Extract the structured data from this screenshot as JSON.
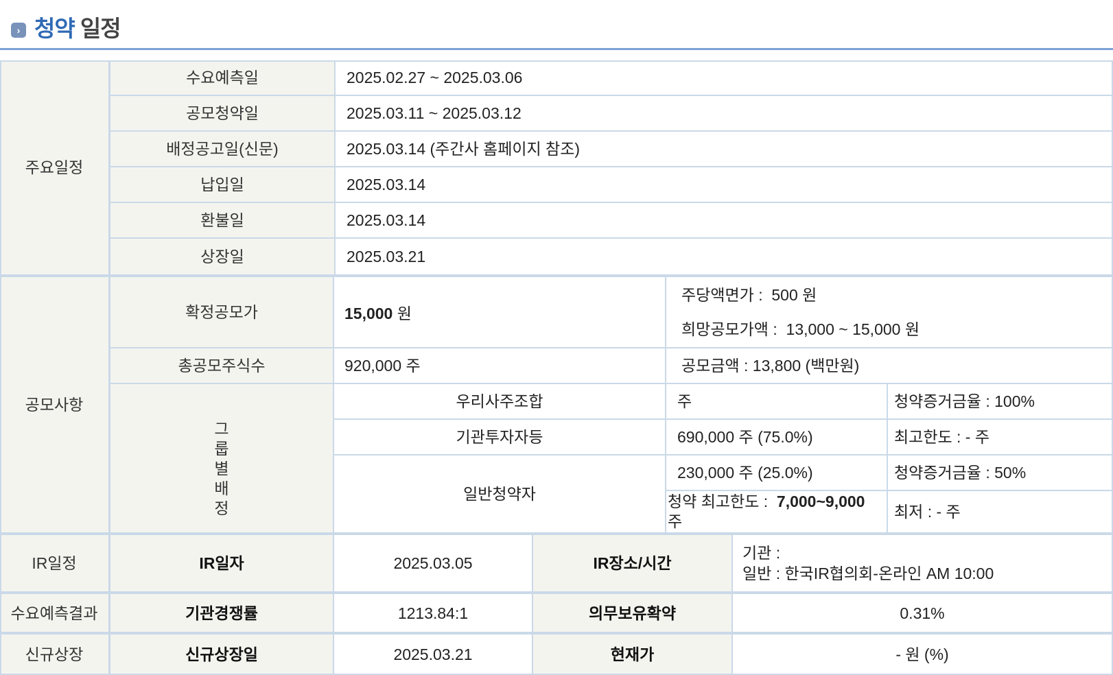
{
  "header": {
    "title_part1": "청약",
    "title_part2": "일정",
    "icon": "chevron-right-icon",
    "accent": "#2f6ab5"
  },
  "schedule": {
    "group_label": "주요일정",
    "rows": [
      {
        "label": "수요예측일",
        "value": "2025.02.27  ~   2025.03.06"
      },
      {
        "label": "공모청약일",
        "value": "2025.03.11  ~   2025.03.12"
      },
      {
        "label": "배정공고일(신문)",
        "value": "2025.03.14 (주간사 홈페이지 참조)"
      },
      {
        "label": "납입일",
        "value": "2025.03.14"
      },
      {
        "label": "환불일",
        "value": "2025.03.14"
      },
      {
        "label": "상장일",
        "value": "2025.03.21"
      }
    ]
  },
  "offering": {
    "group_label": "공모사항",
    "confirmed_price": {
      "label": "확정공모가",
      "value_number": "15,000",
      "value_unit": "원"
    },
    "par_value": {
      "label": "주당액면가 :",
      "value": "500 원"
    },
    "desired_price": {
      "label": "희망공모가액 :",
      "value": "13,000 ~ 15,000 원"
    },
    "total_shares": {
      "label": "총공모주식수",
      "value": "920,000 주"
    },
    "offering_amount": {
      "value": "공모금액 : 13,800 (백만원)"
    },
    "allocation": {
      "label_chars": [
        "그",
        "룹",
        "별",
        "배",
        "정"
      ],
      "employee": {
        "label": "우리사주조합",
        "shares": "주",
        "note": "청약증거금율 : 100%"
      },
      "institution": {
        "label": "기관투자자등",
        "shares": "690,000 주  (75.0%)",
        "note": "최고한도 :  - 주"
      },
      "retail": {
        "label": "일반청약자",
        "shares": "230,000 주  (25.0%)",
        "note": "청약증거금율 : 50%",
        "max_label": "청약 최고한도 :",
        "max_value": "7,000~9,000",
        "max_unit": "주",
        "min_note": "최저 :  - 주"
      }
    }
  },
  "ir": {
    "group_label": "IR일정",
    "date_label": "IR일자",
    "date_value": "2025.03.05",
    "place_label": "IR장소/시간",
    "place_line1": "기관 :",
    "place_line2": "일반 : 한국IR협의회-온라인 AM 10:00"
  },
  "demand": {
    "group_label": "수요예측결과",
    "competition_label": "기관경쟁률",
    "competition_value": "1213.84:1",
    "lockup_label": "의무보유확약",
    "lockup_value": "0.31%"
  },
  "listing": {
    "group_label": "신규상장",
    "date_label": "신규상장일",
    "date_value": "2025.03.21",
    "price_label": "현재가",
    "price_value": "- 원 (%)"
  }
}
